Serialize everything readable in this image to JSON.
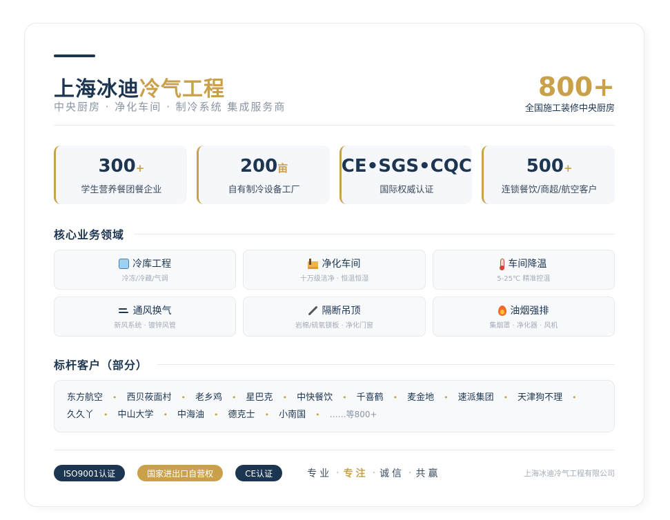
{
  "header": {
    "title_main": "上海冰迪",
    "title_accent": "冷气工程",
    "subtitle": "中央厨房 · 净化车间 · 制冷系统 集成服务商",
    "big_stat_value": "800+",
    "big_stat_label": "全国施工装修中央厨房"
  },
  "stats": [
    {
      "value": "300",
      "suffix": "+",
      "label": "学生营养餐团餐企业"
    },
    {
      "value": "200",
      "suffix": "亩",
      "label": "自有制冷设备工厂"
    },
    {
      "value": "CE•SGS•CQC",
      "suffix": "",
      "label": "国际权威认证"
    },
    {
      "value": "500",
      "suffix": "+",
      "label": "连锁餐饮/商超/航空客户"
    }
  ],
  "business": {
    "heading": "核心业务领域",
    "items": [
      {
        "icon": "ice-cube-icon",
        "title": "冷库工程",
        "sub": "冷冻/冷藏/气调"
      },
      {
        "icon": "factory-icon",
        "title": "净化车间",
        "sub": "十万级洁净 · 恒温恒湿"
      },
      {
        "icon": "thermometer-icon",
        "title": "车间降温",
        "sub": "5-25℃ 精准控温"
      },
      {
        "icon": "wind-icon",
        "title": "通风换气",
        "sub": "新风系统 · 镀锌风管"
      },
      {
        "icon": "wrench-icon",
        "title": "隔断吊顶",
        "sub": "岩棉/硫氧镁板 · 净化门窗"
      },
      {
        "icon": "fire-icon",
        "title": "油烟强排",
        "sub": "集烟罩 · 净化器 · 风机"
      }
    ]
  },
  "clients": {
    "heading": "标杆客户（部分）",
    "names": [
      "东方航空",
      "西贝莜面村",
      "老乡鸡",
      "星巴克",
      "中快餐饮",
      "千喜鹤",
      "麦金地",
      "速派集团",
      "天津狗不理",
      "久久丫",
      "中山大学",
      "中海油",
      "德克士",
      "小南国"
    ],
    "more": "……等800+"
  },
  "footer": {
    "badges": [
      {
        "label": "ISO9001认证",
        "color": "#1c3551"
      },
      {
        "label": "国家进出口自营权",
        "color": "#c9a14a"
      },
      {
        "label": "CE认证",
        "color": "#1c3551"
      }
    ],
    "motto": [
      "专业",
      "专注",
      "诚信",
      "共赢"
    ],
    "company": "上海冰迪冷气工程有限公司"
  },
  "colors": {
    "navy": "#1c3551",
    "gold": "#c9a14a"
  }
}
